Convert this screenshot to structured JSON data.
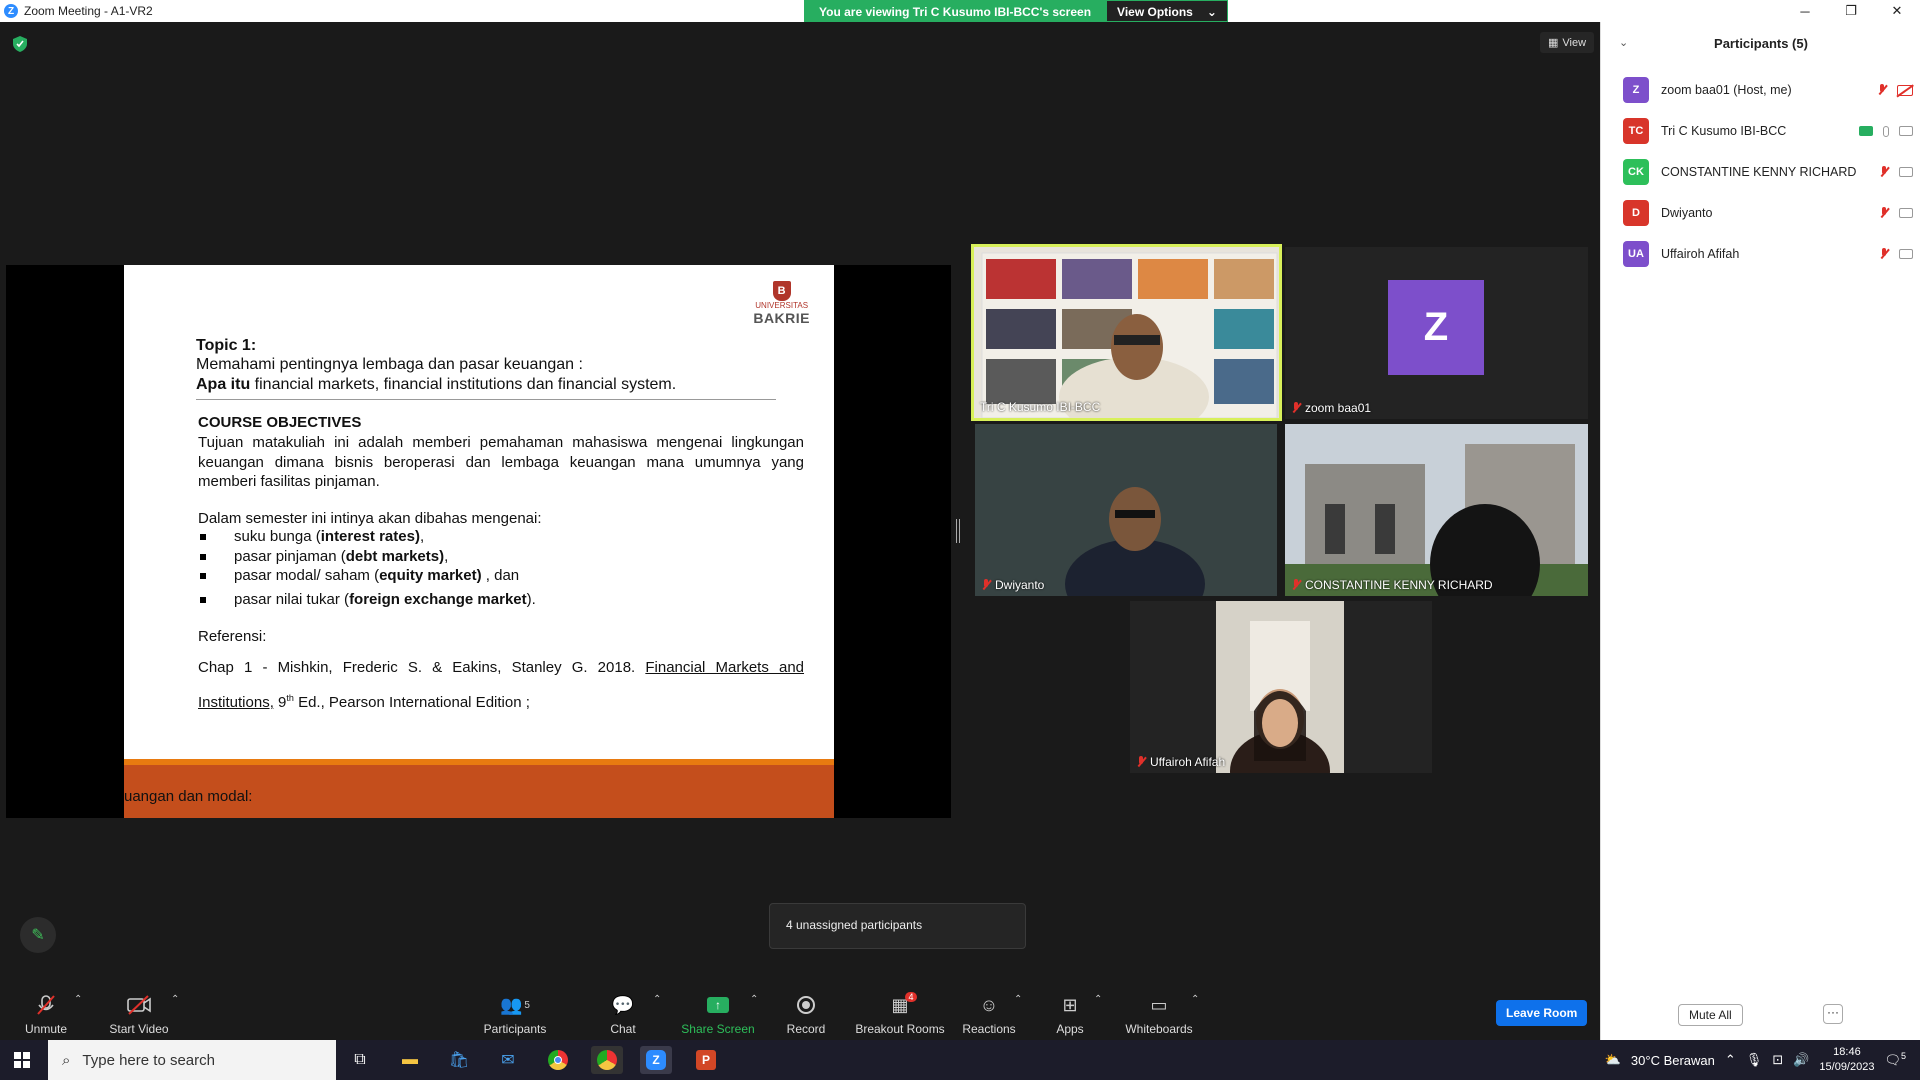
{
  "window": {
    "title": "Zoom Meeting - A1-VR2"
  },
  "banner": {
    "viewing": "You are viewing Tri C Kusumo IBI-BCC's screen",
    "view_options": "View Options"
  },
  "view_label": "View",
  "slide": {
    "logo_small": "UNIVERSITAS",
    "logo_name": "BAKRIE",
    "topic": "Topic 1:",
    "line2": "Memahami pentingnya lembaga dan pasar keuangan :",
    "line3_bold": "Apa itu",
    "line3_rest": " financial markets,  financial institutions dan financial system.",
    "objectives_title": "COURSE OBJECTIVES",
    "objectives_text": "Tujuan matakuliah ini adalah memberi pemahaman mahasiswa mengenai lingkungan keuangan dimana bisnis beroperasi dan lembaga keuangan mana umumnya yang memberi fasilitas pinjaman.",
    "intro": "Dalam semester ini intinya  akan dibahas mengenai:",
    "bullets": [
      {
        "pre": "suku bunga (",
        "bold": "interest rates)",
        "post": ","
      },
      {
        "pre": "pasar  pinjaman (",
        "bold": "debt markets)",
        "post": ","
      },
      {
        "pre": "pasar modal/ saham (",
        "bold": "equity market)",
        "post": " , dan"
      },
      {
        "pre": "pasar nilai tukar (",
        "bold": "foreign exchange market",
        "post": ")."
      }
    ],
    "ref_title": "Referensi:",
    "cite_pre": "Chap 1 - Mishkin, Frederic S. & Eakins, Stanley G. 2018. ",
    "cite_link": "Financial Markets and Institutions,",
    "cite_ed": " 9",
    "cite_sup": "th",
    "cite_post": " Ed., Pearson International Edition ;",
    "footer": "uangan dan  modal:"
  },
  "tiles": [
    {
      "name": "Tri C Kusumo IBI-BCC"
    },
    {
      "name": "zoom baa01",
      "avatar": "Z"
    },
    {
      "name": "Dwiyanto"
    },
    {
      "name": "CONSTANTINE KENNY RICHARD"
    },
    {
      "name": "Uffairoh Afifah"
    }
  ],
  "popup": "4 unassigned participants",
  "toolbar": {
    "unmute": "Unmute",
    "start_video": "Start Video",
    "participants": "Participants",
    "participants_count": "5",
    "chat": "Chat",
    "share_screen": "Share Screen",
    "record": "Record",
    "breakout": "Breakout Rooms",
    "breakout_badge": "4",
    "reactions": "Reactions",
    "apps": "Apps",
    "whiteboards": "Whiteboards",
    "leave": "Leave Room"
  },
  "panel": {
    "title": "Participants (5)",
    "participants": [
      {
        "initials": "Z",
        "name": "zoom baa01 (Host, me)",
        "color": "#7d4fcb"
      },
      {
        "initials": "TC",
        "name": "Tri C Kusumo IBI-BCC",
        "color": "#d8352a"
      },
      {
        "initials": "CK",
        "name": "CONSTANTINE KENNY RICHARD",
        "color": "#2dbf5a"
      },
      {
        "initials": "D",
        "name": "Dwiyanto",
        "color": "#d8352a"
      },
      {
        "initials": "UA",
        "name": "Uffairoh Afifah",
        "color": "#7d4fcb"
      }
    ],
    "mute_all": "Mute All",
    "more": "···"
  },
  "taskbar": {
    "search_placeholder": "Type here to search",
    "weather": "30°C  Berawan",
    "time": "18:46",
    "date": "15/09/2023",
    "notif": "5"
  }
}
